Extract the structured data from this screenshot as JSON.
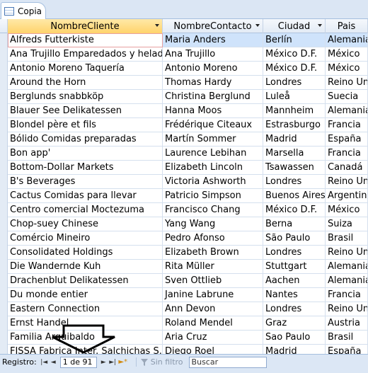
{
  "tab": {
    "label": "Copia"
  },
  "columns": [
    {
      "label": "NombreCliente"
    },
    {
      "label": "NombreContacto"
    },
    {
      "label": "Ciudad"
    },
    {
      "label": "Pais"
    }
  ],
  "rows": [
    [
      "Alfreds Futterkiste",
      "Maria Anders",
      "Berlín",
      "Alemania"
    ],
    [
      "Ana Trujillo Emparedados y helados",
      "Ana Trujillo",
      "México D.F.",
      "México"
    ],
    [
      "Antonio Moreno Taquería",
      "Antonio Moreno",
      "México D.F.",
      "México"
    ],
    [
      "Around the Horn",
      "Thomas Hardy",
      "Londres",
      "Reino Unido"
    ],
    [
      "Berglunds snabbköp",
      "Christina Berglund",
      "Luleå",
      "Suecia"
    ],
    [
      "Blauer See Delikatessen",
      "Hanna Moos",
      "Mannheim",
      "Alemania"
    ],
    [
      "Blondel père et fils",
      "Frédérique Citeaux",
      "Estrasburgo",
      "Francia"
    ],
    [
      "Bólido Comidas preparadas",
      "Martín Sommer",
      "Madrid",
      "España"
    ],
    [
      "Bon app'",
      "Laurence Lebihan",
      "Marsella",
      "Francia"
    ],
    [
      "Bottom-Dollar Markets",
      "Elizabeth Lincoln",
      "Tsawassen",
      "Canadá"
    ],
    [
      "B's Beverages",
      "Victoria Ashworth",
      "Londres",
      "Reino Unido"
    ],
    [
      "Cactus Comidas para llevar",
      "Patricio Simpson",
      "Buenos Aires",
      "Argentina"
    ],
    [
      "Centro comercial Moctezuma",
      "Francisco Chang",
      "México D.F.",
      "México"
    ],
    [
      "Chop-suey Chinese",
      "Yang Wang",
      "Berna",
      "Suiza"
    ],
    [
      "Comércio Mineiro",
      "Pedro Afonso",
      "São Paulo",
      "Brasil"
    ],
    [
      "Consolidated Holdings",
      "Elizabeth Brown",
      "Londres",
      "Reino Unido"
    ],
    [
      "Die Wandernde Kuh",
      "Rita Müller",
      "Stuttgart",
      "Alemania"
    ],
    [
      "Drachenblut Delikatessen",
      "Sven Ottlieb",
      "Aachen",
      "Alemania"
    ],
    [
      "Du monde entier",
      "Janine Labrune",
      "Nantes",
      "Francia"
    ],
    [
      "Eastern Connection",
      "Ann Devon",
      "Londres",
      "Reino Unido"
    ],
    [
      "Ernst Handel",
      "Roland Mendel",
      "Graz",
      "Austria"
    ],
    [
      "Familia Arquibaldo",
      "Aria Cruz",
      "Sao Paulo",
      "Brasil"
    ],
    [
      "FISSA Fabrica Inter. Salchichas S.A.",
      "Diego Roel",
      "Madrid",
      "España"
    ]
  ],
  "nav": {
    "label": "Registro:",
    "record": "1 de 91",
    "filter": "Sin filtro",
    "search_placeholder": "Buscar"
  }
}
